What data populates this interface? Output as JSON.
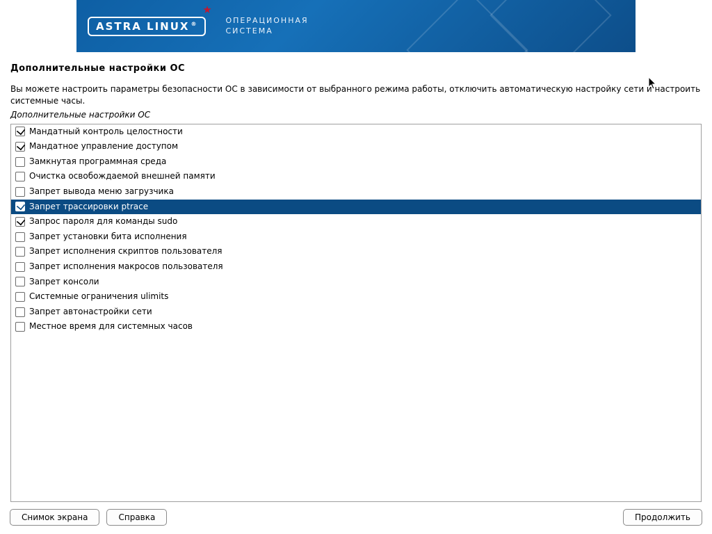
{
  "brand": {
    "name": "ASTRA LINUX",
    "reg": "®",
    "subtitle_l1": "ОПЕРАЦИОННАЯ",
    "subtitle_l2": "СИСТЕМА"
  },
  "page": {
    "title": "Дополнительные настройки ОС",
    "intro": "Вы можете настроить параметры безопасности ОС в зависимости от выбранного режима работы, отключить автоматическую настройку сети и настроить системные часы.",
    "subhead": "Дополнительные настройки ОС"
  },
  "options": [
    {
      "label": "Мандатный контроль целостности",
      "checked": true,
      "selected": false
    },
    {
      "label": "Мандатное управление доступом",
      "checked": true,
      "selected": false
    },
    {
      "label": "Замкнутая программная среда",
      "checked": false,
      "selected": false
    },
    {
      "label": "Очистка освобождаемой внешней памяти",
      "checked": false,
      "selected": false
    },
    {
      "label": "Запрет вывода меню загрузчика",
      "checked": false,
      "selected": false
    },
    {
      "label": "Запрет трассировки ptrace",
      "checked": true,
      "selected": true
    },
    {
      "label": "Запрос пароля для команды sudo",
      "checked": true,
      "selected": false
    },
    {
      "label": "Запрет установки бита исполнения",
      "checked": false,
      "selected": false
    },
    {
      "label": "Запрет исполнения скриптов пользователя",
      "checked": false,
      "selected": false
    },
    {
      "label": "Запрет исполнения макросов пользователя",
      "checked": false,
      "selected": false
    },
    {
      "label": "Запрет консоли",
      "checked": false,
      "selected": false
    },
    {
      "label": "Системные ограничения ulimits",
      "checked": false,
      "selected": false
    },
    {
      "label": "Запрет автонастройки сети",
      "checked": false,
      "selected": false
    },
    {
      "label": "Местное время для системных часов",
      "checked": false,
      "selected": false
    }
  ],
  "buttons": {
    "screenshot": "Снимок экрана",
    "help": "Справка",
    "continue": "Продолжить"
  }
}
